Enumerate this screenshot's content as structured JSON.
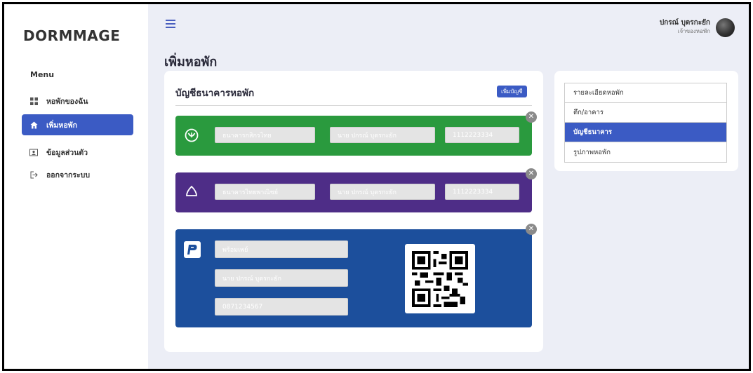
{
  "app": {
    "logo": "DORMMAGE"
  },
  "sidebar": {
    "menu_title": "Menu",
    "items": [
      {
        "label": "หอพักของฉัน",
        "icon": "grid-icon",
        "active": false
      },
      {
        "label": "เพิ่มหอพัก",
        "icon": "home-icon",
        "active": true
      },
      {
        "label": "ข้อมูลส่วนตัว",
        "icon": "id-card-icon",
        "active": false
      },
      {
        "label": "ออกจากระบบ",
        "icon": "logout-icon",
        "active": false
      }
    ]
  },
  "header": {
    "user_name": "ปกรณ์ บุตรกะยัก",
    "user_role": "เจ้าของหอพัก"
  },
  "page": {
    "title": "เพิ่มหอพัก"
  },
  "main": {
    "heading": "บัญชีธนาคารหอพัก",
    "add_button": "เพิ่มบัญชี",
    "accounts": [
      {
        "bank_name": "ธนาคารกสิกรไทย",
        "account_name": "นาย ปกรณ์ บุตรกะยัก",
        "account_number": "1112223334",
        "color": "#2a9a3e",
        "icon": "kasikorn-icon"
      },
      {
        "bank_name": "ธนาคารไทยพาณิชย์",
        "account_name": "นาย ปกรณ์ บุตรกะยัก",
        "account_number": "1112223334",
        "color": "#4e2d87",
        "icon": "scb-icon"
      }
    ],
    "promptpay": {
      "label": "พร้อมเพย์",
      "account_name": "นาย ปกรณ์ บุตรกะยัก",
      "phone": "0871234567",
      "color": "#1c4f9c",
      "icon": "promptpay-icon"
    }
  },
  "right_panel": {
    "items": [
      {
        "label": "รายละเอียดหอพัก",
        "active": false
      },
      {
        "label": "ตึก/อาคาร",
        "active": false
      },
      {
        "label": "บัญชีธนาคาร",
        "active": true
      },
      {
        "label": "รูปภาพหอพัก",
        "active": false
      }
    ]
  },
  "colors": {
    "accent": "#3b5bc4",
    "background": "#eceef6"
  }
}
